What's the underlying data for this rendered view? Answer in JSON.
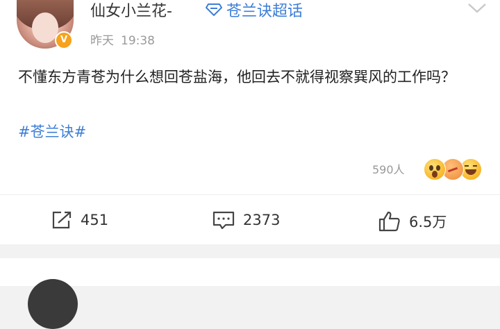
{
  "post": {
    "user": {
      "name": "仙女小兰花-",
      "verified_badge": "V",
      "avatar_icon": "avatar"
    },
    "topic_link": {
      "icon": "super-topic-diamond-icon",
      "label": "苍兰诀超话"
    },
    "time": {
      "day": "昨天",
      "clock": "19:38"
    },
    "content": "不懂东方青苍为什么想回苍盐海，他回去不就得视察巽风的工作吗？",
    "hashtag": "#苍兰诀#",
    "reactions": {
      "count": "590人",
      "emojis": [
        "surprised-emoji",
        "laugh-cry-emoji",
        "grin-emoji"
      ]
    },
    "actions": [
      {
        "name": "repost",
        "icon": "share-icon",
        "count": "451"
      },
      {
        "name": "comment",
        "icon": "comment-icon",
        "count": "2373"
      },
      {
        "name": "like",
        "icon": "thumbs-up-icon",
        "count": "6.5万"
      }
    ]
  },
  "colors": {
    "link": "#3d7ed8",
    "badge": "#f7a21b",
    "background": "#f2f2f2"
  }
}
